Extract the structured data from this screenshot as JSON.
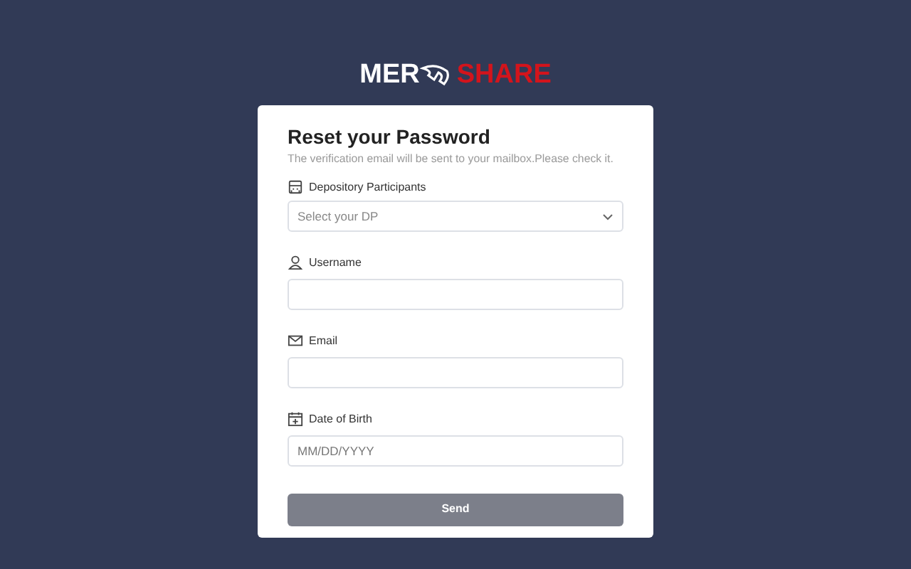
{
  "logo": {
    "left": "MER",
    "right": "SHARE"
  },
  "card": {
    "title": "Reset your Password",
    "subtitle": "The verification email will be sent to your mailbox.Please check it.",
    "fields": [
      {
        "kind": "select",
        "label": "Depository Participants",
        "placeholder": "Select your DP"
      },
      {
        "kind": "input",
        "label": "Username"
      },
      {
        "kind": "input",
        "label": "Email"
      },
      {
        "kind": "input",
        "label": "Date of Birth",
        "placeholder": "MM/DD/YYYY"
      }
    ],
    "button": {
      "label": "Send",
      "disabled": true
    }
  }
}
